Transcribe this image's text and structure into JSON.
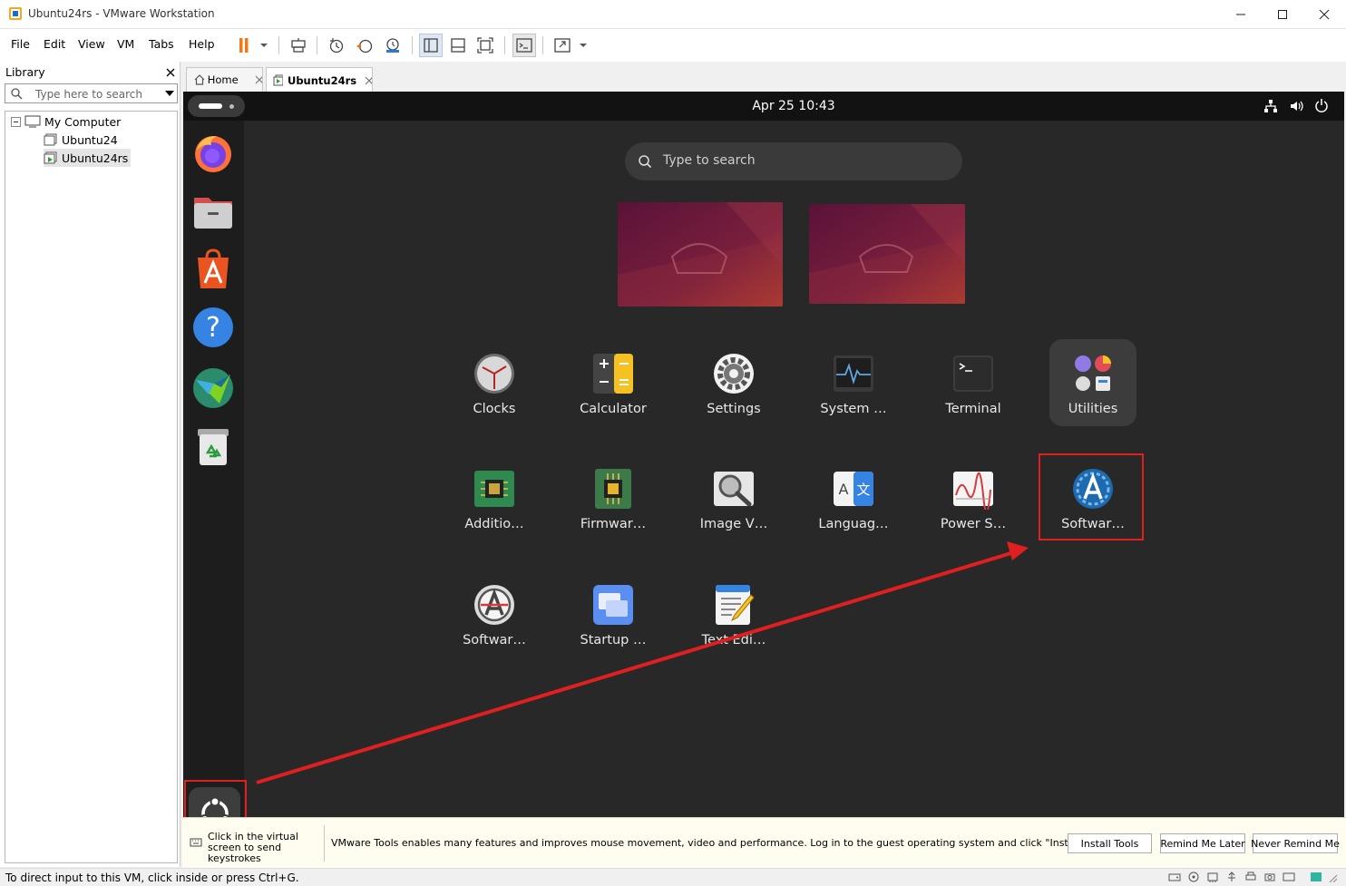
{
  "window": {
    "title": "Ubuntu24rs - VMware Workstation"
  },
  "menu": [
    "File",
    "Edit",
    "View",
    "VM",
    "Tabs",
    "Help"
  ],
  "library": {
    "title": "Library",
    "search_placeholder": "Type here to search",
    "tree": [
      {
        "label": "My Computer",
        "type": "root"
      },
      {
        "label": "Ubuntu24",
        "type": "vm"
      },
      {
        "label": "Ubuntu24rs",
        "type": "vm-running",
        "selected": true
      }
    ]
  },
  "tabs": [
    {
      "label": "Home",
      "icon": "home-icon"
    },
    {
      "label": "Ubuntu24rs",
      "icon": "vm-running-icon",
      "active": true
    }
  ],
  "ubuntu": {
    "clock": "Apr 25  10:43",
    "search_placeholder": "Type to search",
    "dock": [
      "firefox",
      "files",
      "app-center",
      "help",
      "remote-desktop",
      "trash",
      "show-apps"
    ],
    "apps_row1": [
      "Clocks",
      "Calculator",
      "Settings",
      "System …",
      "Terminal",
      "Utilities"
    ],
    "apps_row2": [
      "Additio…",
      "Firmwar…",
      "Image V…",
      "Languag…",
      "Power S…",
      "Softwar…"
    ],
    "apps_row3": [
      "Softwar…",
      "Startup …",
      "Text Edi…"
    ]
  },
  "notice": {
    "click_hint": "Click in the virtual screen to send keystrokes",
    "message": "VMware Tools enables many features and improves mouse movement, video and performance. Log in to the guest operating system and click \"Install Tools\".",
    "buttons": [
      "Install Tools",
      "Remind Me Later",
      "Never Remind Me"
    ]
  },
  "status": {
    "text": "To direct input to this VM, click inside or press Ctrl+G."
  },
  "colors": {
    "accent_red": "#e02020",
    "ubuntu_blue": "#1c6bb0",
    "vm_bg": "#282828"
  }
}
